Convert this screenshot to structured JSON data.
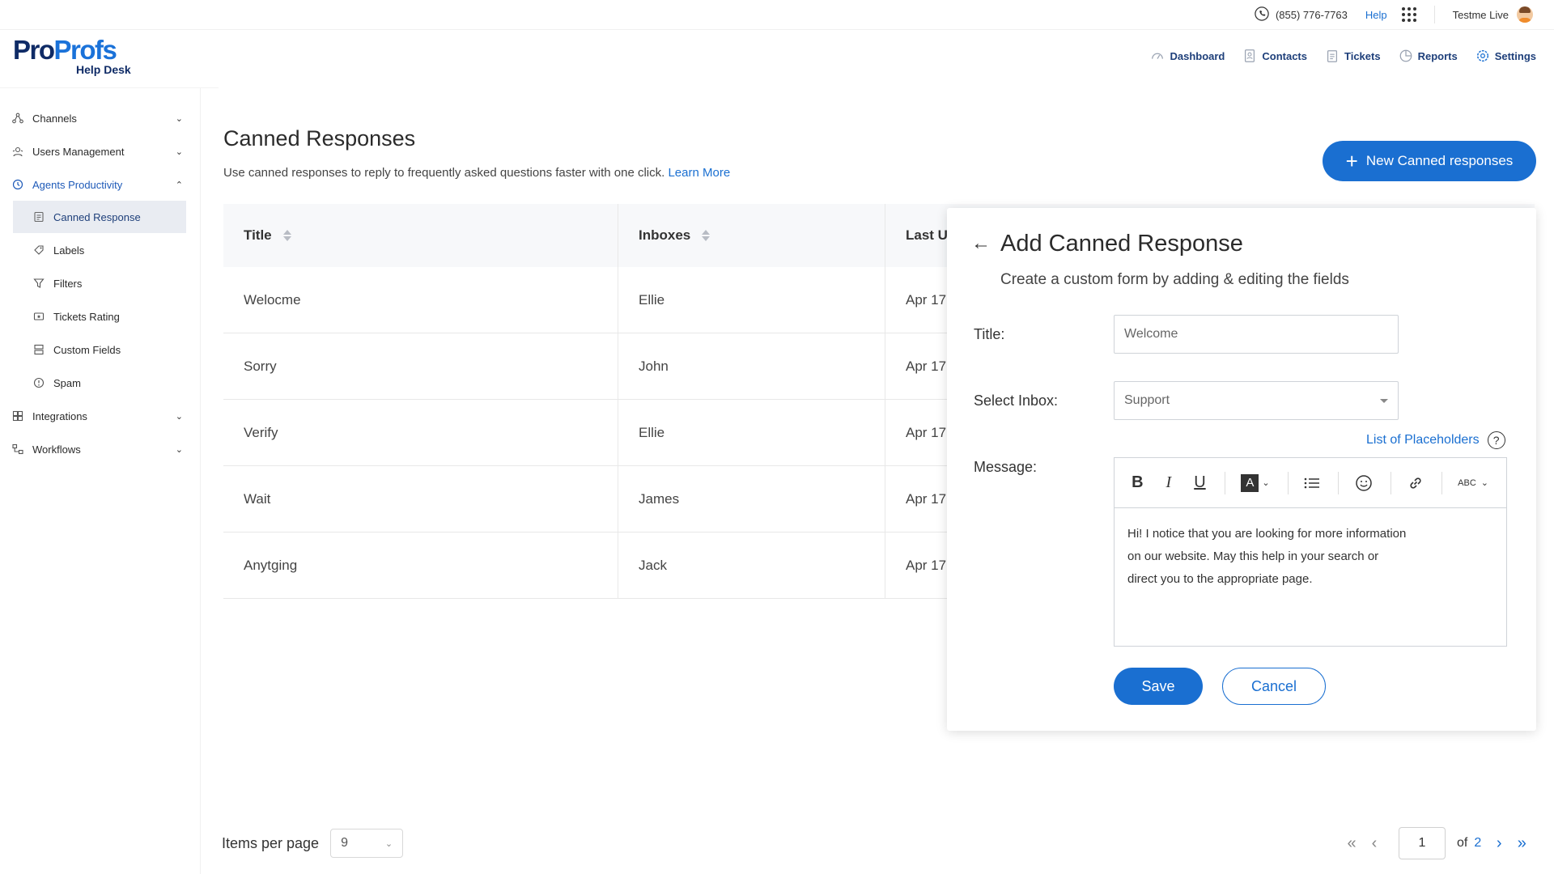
{
  "topbar": {
    "phone": "(855) 776-7763",
    "help": "Help",
    "user_name": "Testme Live"
  },
  "logo": {
    "word_part1": "Pro",
    "word_part2": "Profs",
    "product": "Help Desk"
  },
  "main_nav": [
    {
      "label": "Dashboard",
      "icon": "dashboard-icon"
    },
    {
      "label": "Contacts",
      "icon": "contacts-icon"
    },
    {
      "label": "Tickets",
      "icon": "tickets-icon"
    },
    {
      "label": "Reports",
      "icon": "reports-icon"
    },
    {
      "label": "Settings",
      "icon": "settings-icon"
    }
  ],
  "sidebar": {
    "items": [
      {
        "label": "Channels",
        "icon": "channels-icon",
        "expandable": true
      },
      {
        "label": "Users Management",
        "icon": "users-icon",
        "expandable": true
      },
      {
        "label": "Agents Productivity",
        "icon": "productivity-icon",
        "expandable": true,
        "expanded": true
      },
      {
        "label": "Canned Response",
        "icon": "canned-response-icon",
        "active": true
      },
      {
        "label": "Labels",
        "icon": "label-icon"
      },
      {
        "label": "Filters",
        "icon": "filter-icon"
      },
      {
        "label": "Tickets Rating",
        "icon": "rating-icon"
      },
      {
        "label": "Custom Fields",
        "icon": "custom-fields-icon"
      },
      {
        "label": "Spam",
        "icon": "spam-icon"
      },
      {
        "label": "Integrations",
        "icon": "integrations-icon",
        "expandable": true
      },
      {
        "label": "Workflows",
        "icon": "workflows-icon",
        "expandable": true
      }
    ]
  },
  "page": {
    "title": "Canned Responses",
    "description": "Use canned responses to reply to frequently asked questions faster with one click.",
    "learn_more": "Learn More",
    "new_button": "New Canned responses"
  },
  "table": {
    "columns": [
      "Title",
      "Inboxes",
      "Last U"
    ],
    "rows": [
      [
        "Welocme",
        "Ellie",
        "Apr 17"
      ],
      [
        "Sorry",
        "John",
        "Apr 17"
      ],
      [
        "Verify",
        "Ellie",
        "Apr 17"
      ],
      [
        "Wait",
        "James",
        "Apr 17"
      ],
      [
        "Anytging",
        "Jack",
        "Apr 17"
      ]
    ]
  },
  "pagination": {
    "items_per_page_label": "Items per page",
    "items_per_page": "9",
    "current_page": "1",
    "of_label": "of",
    "total_pages": "2"
  },
  "panel": {
    "title": "Add Canned Response",
    "subtitle": "Create a custom form by adding & editing the fields",
    "title_label": "Title:",
    "title_placeholder": "Welcome",
    "inbox_label": "Select Inbox:",
    "inbox_value": "Support",
    "placeholders_link": "List of Placeholders",
    "help_mark": "?",
    "message_label": "Message:",
    "toolbar": {
      "bold": "B",
      "italic": "I",
      "underline": "U",
      "font_color": "A",
      "spellcheck": "ABC"
    },
    "message_text": "Hi! I notice that you are looking for more information on our website. May this help in your search or direct you to the appropriate page.",
    "save": "Save",
    "cancel": "Cancel"
  },
  "colors": {
    "accent": "#1a6fd1",
    "navy": "#0f2b66",
    "active_bg": "#e9ecf2"
  }
}
